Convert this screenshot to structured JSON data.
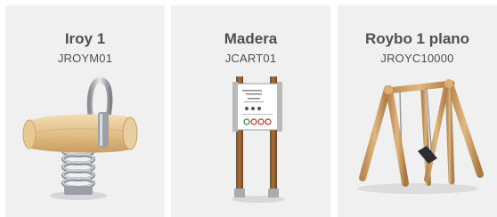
{
  "products": [
    {
      "name": "Iroy 1",
      "code": "JROYM01",
      "image_icon": "spring-rider-icon"
    },
    {
      "name": "Madera",
      "code": "JCART01",
      "image_icon": "information-sign-icon"
    },
    {
      "name": "Roybo 1 plano",
      "code": "JROYC10000",
      "image_icon": "swing-frame-icon"
    }
  ],
  "colors": {
    "card_bg": "#f0f0f0",
    "text": "#505050"
  }
}
